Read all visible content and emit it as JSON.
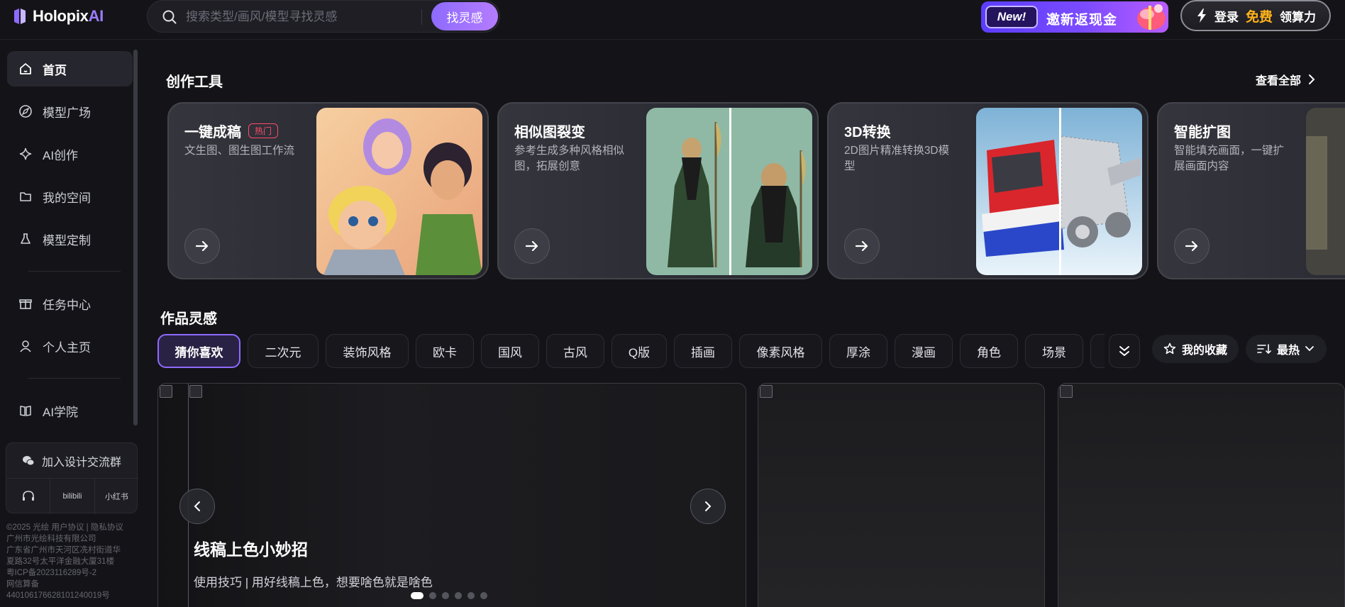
{
  "header": {
    "logo_text": "Holopix",
    "logo_ai": "AI",
    "search_placeholder": "搜索类型/画风/模型寻找灵感",
    "search_button": "找灵感",
    "invite_badge": "New!",
    "invite_text": "邀新返现金",
    "login_text": "登录",
    "login_free": "免费",
    "login_suffix": "领算力"
  },
  "sidebar": {
    "items": [
      {
        "label": "首页",
        "icon": "home-icon"
      },
      {
        "label": "模型广场",
        "icon": "compass-icon"
      },
      {
        "label": "AI创作",
        "icon": "sparkle-icon"
      },
      {
        "label": "我的空间",
        "icon": "folder-icon"
      },
      {
        "label": "模型定制",
        "icon": "flask-icon"
      },
      {
        "label": "任务中心",
        "icon": "gift-box-icon"
      },
      {
        "label": "个人主页",
        "icon": "user-icon"
      },
      {
        "label": "AI学院",
        "icon": "book-icon"
      }
    ],
    "join_group": "加入设计交流群",
    "join_icons": [
      "headset-icon",
      "bilibili-icon",
      "xiaohongshu-icon"
    ],
    "bilibili_label": "bilibili",
    "xiaohongshu_label": "小红书",
    "footer_lines": [
      "©2025 光绘 用户协议 | 隐私协议",
      "广州市光绘科技有限公司",
      "广东省广州市天河区冼村街道华",
      "夏路32号太平洋金融大厦31楼",
      "粤ICP备2023116289号-2",
      "网信算备",
      "440106176628101240019号"
    ]
  },
  "tools": {
    "title": "创作工具",
    "see_all": "查看全部",
    "cards": [
      {
        "title": "一键成稿",
        "badge": "热门",
        "desc": "文生图、图生图工作流"
      },
      {
        "title": "相似图裂变",
        "badge": "",
        "desc": "参考生成多种风格相似图，拓展创意"
      },
      {
        "title": "3D转换",
        "badge": "",
        "desc": "2D图片精准转换3D模型"
      },
      {
        "title": "智能扩图",
        "badge": "",
        "desc": "智能填充画面，一键扩展画面内容"
      }
    ]
  },
  "inspiration": {
    "title": "作品灵感",
    "chips": [
      "猜你喜欢",
      "二次元",
      "装饰风格",
      "欧卡",
      "国风",
      "古风",
      "Q版",
      "插画",
      "像素风格",
      "厚涂",
      "漫画",
      "角色",
      "场景"
    ],
    "active_chip": "猜你喜欢",
    "favorites": "我的收藏",
    "sort": "最热"
  },
  "feature": {
    "title": "线稿上色小妙招",
    "subtitle": "使用技巧 | 用好线稿上色，想要啥色就是啥色",
    "slides": 6,
    "active_slide": 1
  },
  "colors": {
    "accent": "#8e6bff",
    "hot": "#ff4b6b",
    "free": "#ffb21a",
    "background": "#141418"
  }
}
